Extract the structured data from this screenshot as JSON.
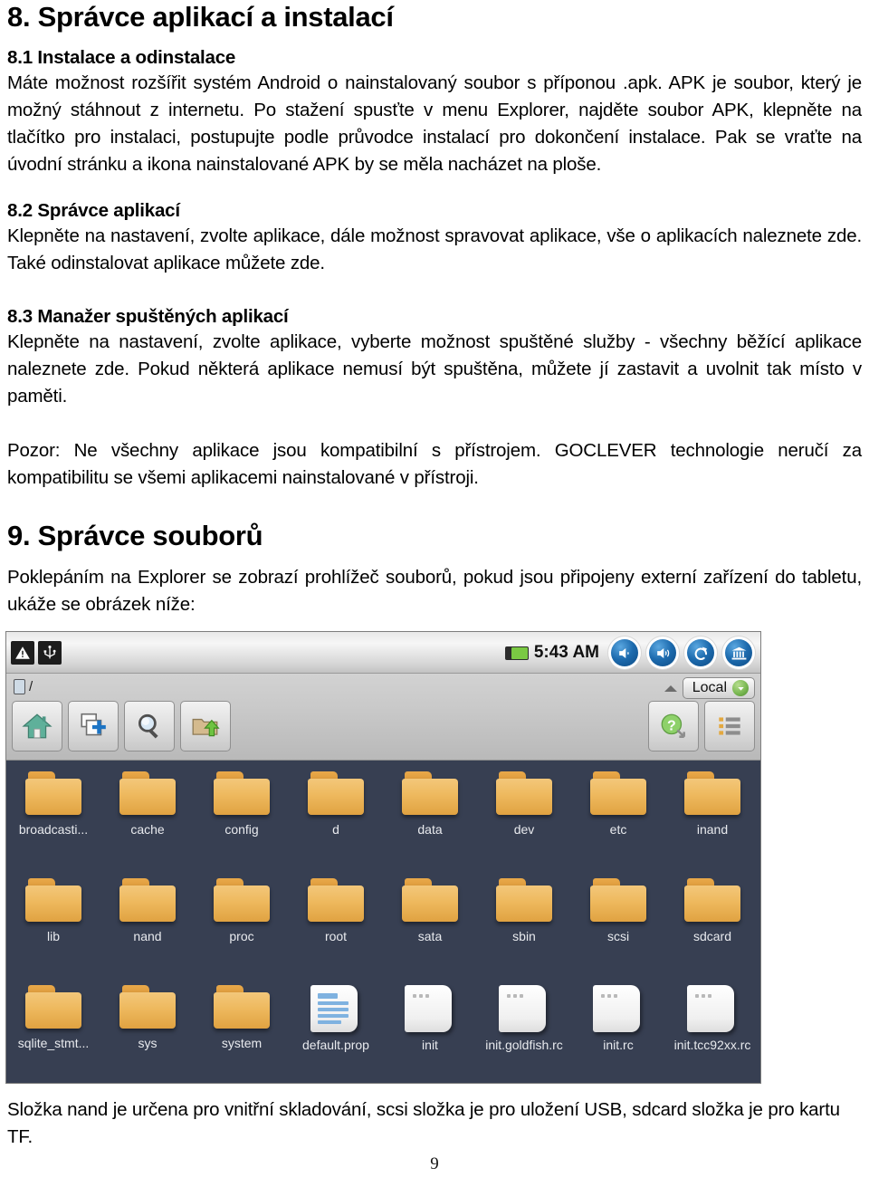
{
  "document": {
    "page_number": "9",
    "heading_8": "8. Správce aplikací a instalací",
    "heading_8_1": "8.1 Instalace a odinstalace",
    "para_8_1": "Máte možnost rozšířit systém Android o nainstalovaný soubor s příponou .apk. APK je soubor, který je možný stáhnout z internetu. Po stažení spusťte v menu Explorer, najděte soubor APK, klepněte na tlačítko pro instalaci, postupujte podle průvodce instalací pro dokončení instalace. Pak se vraťte na úvodní stránku a ikona nainstalované APK by se měla nacházet na ploše.",
    "heading_8_2": "8.2 Správce aplikací",
    "para_8_2": "Klepněte na nastavení, zvolte aplikace, dále možnost spravovat aplikace, vše o aplikacích naleznete zde. Také odinstalovat aplikace můžete zde.",
    "heading_8_3": "8.3 Manažer spuštěných aplikací",
    "para_8_3": "Klepněte na nastavení, zvolte aplikace, vyberte možnost spuštěné služby - všechny běžící aplikace naleznete zde. Pokud některá aplikace nemusí být spuštěna, můžete jí zastavit a uvolnit tak místo v paměti.",
    "para_warning": "Pozor: Ne všechny aplikace jsou kompatibilní s přístrojem. GOCLEVER technologie neručí za kompatibilitu se všemi aplikacemi nainstalované v přístroji.",
    "heading_9": "9. Správce souborů",
    "para_9": "Poklepáním na Explorer se zobrazí prohlížeč souborů, pokud jsou připojeny externí zařízení do tabletu, ukáže se obrázek níže:",
    "para_after_image": "Složka nand je určena pro vnitřní skladování, scsi složka je pro uložení USB, sdcard složka je pro kartu TF."
  },
  "file_manager": {
    "statusbar": {
      "warning_icon": "warning-triangle-icon",
      "usb_icon": "usb-icon",
      "battery_icon": "battery-icon",
      "clock": "5:43 AM",
      "buttons": [
        {
          "name": "volume-down-button",
          "glyph": "volume-down-icon"
        },
        {
          "name": "volume-up-button",
          "glyph": "volume-up-icon"
        },
        {
          "name": "back-button",
          "glyph": "back-arrow-icon"
        },
        {
          "name": "home-button",
          "glyph": "home-building-icon"
        }
      ]
    },
    "path": "/",
    "storage_selector": {
      "label": "Local",
      "caret": "chevron-down-icon"
    },
    "toolbar_left": [
      {
        "name": "home-button",
        "glyph": "house-icon"
      },
      {
        "name": "new-folder-button",
        "glyph": "new-window-plus-icon"
      },
      {
        "name": "search-button",
        "glyph": "magnifier-icon"
      },
      {
        "name": "up-folder-button",
        "glyph": "folder-up-arrow-icon"
      }
    ],
    "toolbar_right": [
      {
        "name": "help-button",
        "glyph": "question-mark-icon"
      },
      {
        "name": "view-list-button",
        "glyph": "list-view-icon"
      }
    ],
    "grid": {
      "rows": [
        [
          {
            "label": "broadcasti...",
            "type": "folder"
          },
          {
            "label": "cache",
            "type": "folder"
          },
          {
            "label": "config",
            "type": "folder"
          },
          {
            "label": "d",
            "type": "folder"
          },
          {
            "label": "data",
            "type": "folder"
          },
          {
            "label": "dev",
            "type": "folder"
          },
          {
            "label": "etc",
            "type": "folder"
          },
          {
            "label": "inand",
            "type": "folder"
          }
        ],
        [
          {
            "label": "lib",
            "type": "folder"
          },
          {
            "label": "nand",
            "type": "folder"
          },
          {
            "label": "proc",
            "type": "folder"
          },
          {
            "label": "root",
            "type": "folder"
          },
          {
            "label": "sata",
            "type": "folder"
          },
          {
            "label": "sbin",
            "type": "folder"
          },
          {
            "label": "scsi",
            "type": "folder"
          },
          {
            "label": "sdcard",
            "type": "folder"
          }
        ],
        [
          {
            "label": "sqlite_stmt...",
            "type": "folder"
          },
          {
            "label": "sys",
            "type": "folder"
          },
          {
            "label": "system",
            "type": "folder"
          },
          {
            "label": "default.prop",
            "type": "file-text"
          },
          {
            "label": "init",
            "type": "file-plain"
          },
          {
            "label": "init.goldfish.rc",
            "type": "file-plain"
          },
          {
            "label": "init.rc",
            "type": "file-plain"
          },
          {
            "label": "init.tcc92xx.rc",
            "type": "file-plain"
          }
        ]
      ]
    },
    "colors": {
      "grid_background": "#373f52",
      "folder": "#eeb95e",
      "accent_blue": "#1d6bae",
      "battery_green": "#7ac943"
    }
  }
}
